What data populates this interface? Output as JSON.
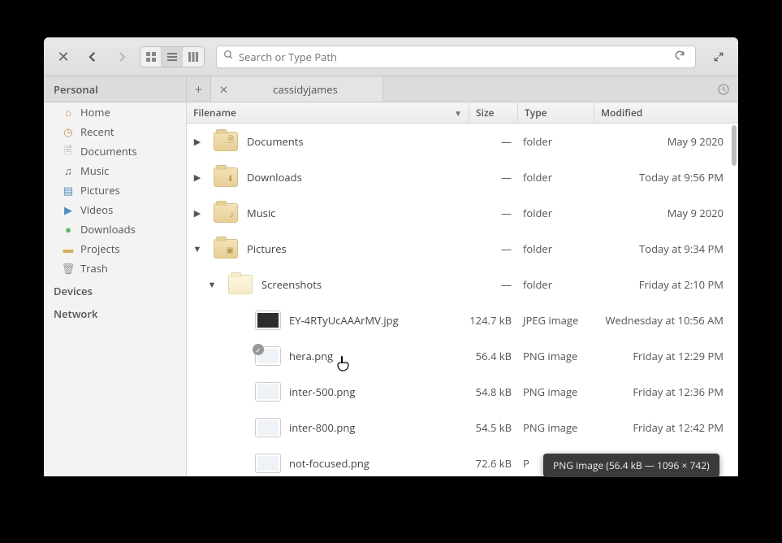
{
  "toolbar": {
    "search_placeholder": "Search or Type Path"
  },
  "sidebar": {
    "sections": {
      "personal": "Personal",
      "devices": "Devices",
      "network": "Network"
    },
    "items": [
      {
        "label": "Home",
        "icon": "home"
      },
      {
        "label": "Recent",
        "icon": "recent"
      },
      {
        "label": "Documents",
        "icon": "doc"
      },
      {
        "label": "Music",
        "icon": "music"
      },
      {
        "label": "Pictures",
        "icon": "pic"
      },
      {
        "label": "Videos",
        "icon": "vid"
      },
      {
        "label": "Downloads",
        "icon": "dl"
      },
      {
        "label": "Projects",
        "icon": "proj"
      },
      {
        "label": "Trash",
        "icon": "trash"
      }
    ]
  },
  "tab": {
    "label": "cassidyjames"
  },
  "columns": {
    "name": "Filename",
    "size": "Size",
    "type": "Type",
    "modified": "Modified"
  },
  "rows": [
    {
      "indent": 1,
      "disclosure": "right",
      "icon": "folder",
      "inner": "doc",
      "name": "Documents",
      "size": "—",
      "type": "folder",
      "modified": "May  9 2020"
    },
    {
      "indent": 1,
      "disclosure": "right",
      "icon": "folder",
      "inner": "dl",
      "name": "Downloads",
      "size": "—",
      "type": "folder",
      "modified": "Today at 9:56 PM"
    },
    {
      "indent": 1,
      "disclosure": "right",
      "icon": "folder",
      "inner": "music",
      "name": "Music",
      "size": "—",
      "type": "folder",
      "modified": "May  9 2020"
    },
    {
      "indent": 1,
      "disclosure": "down",
      "icon": "folder",
      "inner": "pic",
      "name": "Pictures",
      "size": "—",
      "type": "folder",
      "modified": "Today at 9:34 PM"
    },
    {
      "indent": 2,
      "disclosure": "down",
      "icon": "folder-open",
      "name": "Screenshots",
      "size": "—",
      "type": "folder",
      "modified": "Friday at 2:10 PM"
    },
    {
      "indent": 3,
      "icon": "img-dark",
      "name": "EY-4RTyUcAAArMV.jpg",
      "size": "124.7 kB",
      "type": "JPEG image",
      "modified": "Wednesday at 10:56 AM"
    },
    {
      "indent": 3,
      "icon": "img-light",
      "checked": true,
      "name": "hera.png",
      "size": "56.4 kB",
      "type": "PNG image",
      "modified": "Friday at 12:29 PM"
    },
    {
      "indent": 3,
      "icon": "img-light",
      "name": "inter-500.png",
      "size": "54.8 kB",
      "type": "PNG image",
      "modified": "Friday at 12:36 PM"
    },
    {
      "indent": 3,
      "icon": "img-light",
      "name": "inter-800.png",
      "size": "54.5 kB",
      "type": "PNG image",
      "modified": "Friday at 12:42 PM"
    },
    {
      "indent": 3,
      "icon": "img-light",
      "name": "not-focused.png",
      "size": "72.6 kB",
      "type": "P",
      "modified": ""
    }
  ],
  "tooltip": "PNG image (56.4 kB — 1096 × 742)"
}
